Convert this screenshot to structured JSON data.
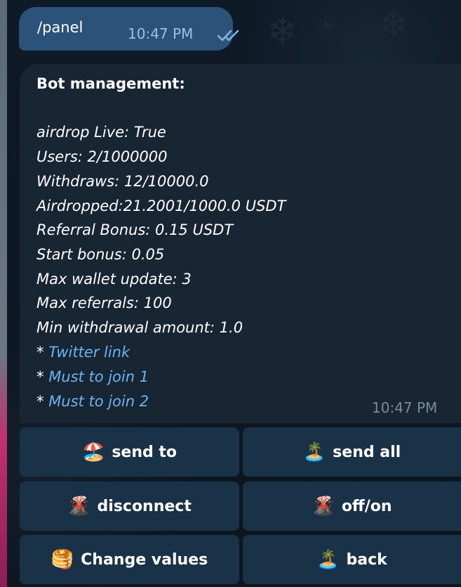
{
  "outgoing": {
    "text": "/panel",
    "time": "10:47 PM",
    "status_icon": "double-check-icon"
  },
  "message": {
    "title": "Bot management:",
    "lines": [
      "airdrop Live: True",
      "Users: 2/1000000",
      "Withdraws: 12/10000.0",
      "Airdropped:21.2001/1000.0 USDT",
      "Referral Bonus: 0.15 USDT",
      "Start bonus: 0.05",
      "Max wallet update: 3",
      "Max referrals: 100",
      "Min withdrawal amount: 1.0"
    ],
    "links": [
      {
        "prefix": "* ",
        "label": "Twitter link"
      },
      {
        "prefix": "* ",
        "label": "Must to join 1"
      },
      {
        "prefix": "* ",
        "label": "Must to join 2"
      }
    ],
    "time": "10:47 PM"
  },
  "keyboard": {
    "buttons": [
      {
        "icon": "🏖️",
        "icon_name": "beach-umbrella-icon",
        "label": "send to"
      },
      {
        "icon": "🏝️",
        "icon_name": "desert-island-icon",
        "label": "send all"
      },
      {
        "icon": "🌋",
        "icon_name": "volcano-icon",
        "label": "disconnect"
      },
      {
        "icon": "🌋",
        "icon_name": "volcano-icon",
        "label": "off/on"
      },
      {
        "icon": "🥞",
        "icon_name": "pancakes-icon",
        "label": "Change values"
      },
      {
        "icon": "🏝️",
        "icon_name": "desert-island-icon",
        "label": "back"
      }
    ]
  },
  "colors": {
    "background": "#0e1621",
    "outgoing_bubble": "#2b5278",
    "incoming_bubble": "#182533",
    "keyboard_button": "#1a3247",
    "link": "#6ab3f3"
  }
}
